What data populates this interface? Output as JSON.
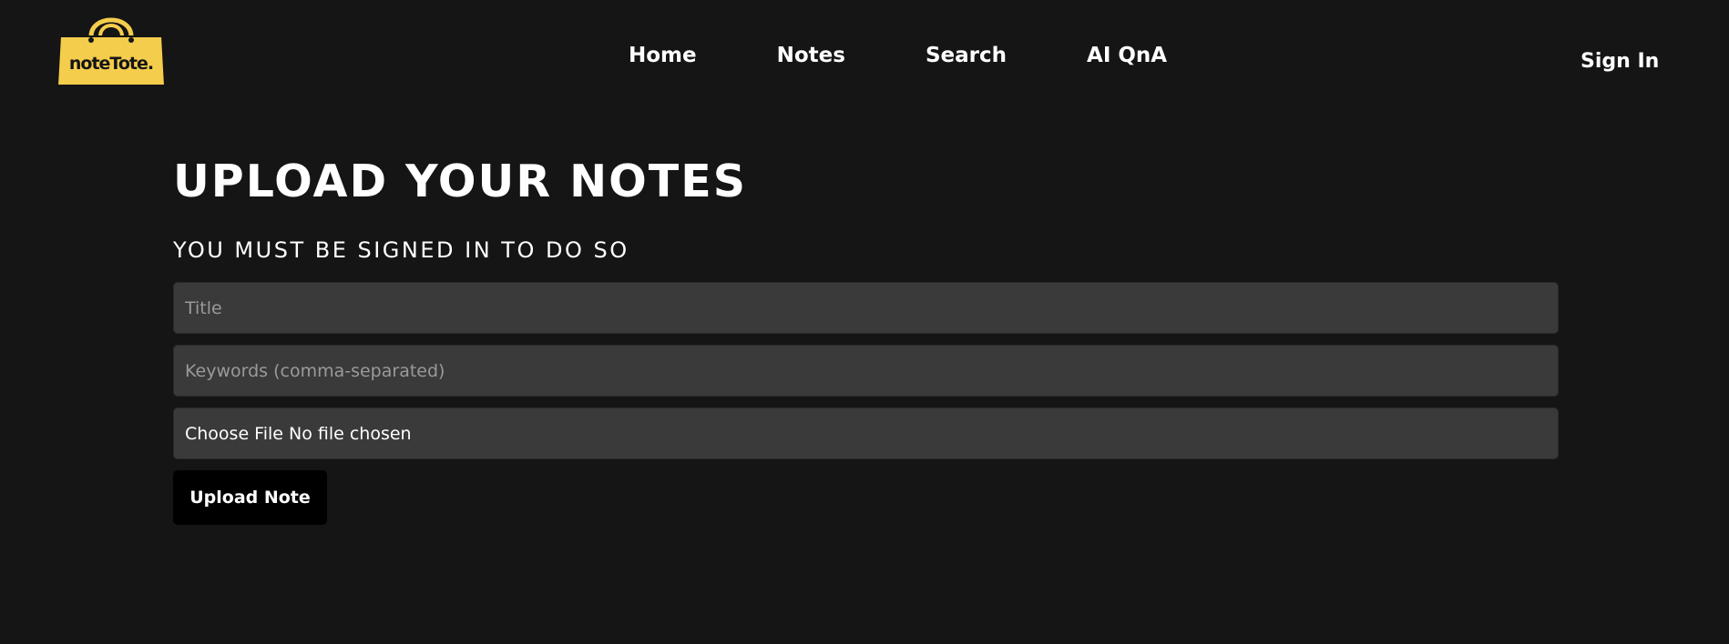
{
  "header": {
    "logo_text": "noteTote.",
    "nav": [
      {
        "label": "Home"
      },
      {
        "label": "Notes"
      },
      {
        "label": "Search"
      },
      {
        "label": "AI QnA"
      }
    ],
    "sign_in_label": "Sign In"
  },
  "main": {
    "title": "UPLOAD YOUR NOTES",
    "subtitle": "YOU MUST BE SIGNED IN TO DO SO",
    "form": {
      "title_placeholder": "Title",
      "keywords_placeholder": "Keywords (comma-separated)",
      "file_button_label": "Choose File",
      "file_status": "No file chosen",
      "submit_label": "Upload Note"
    }
  },
  "colors": {
    "background": "#151515",
    "input_background": "#3a3a3a",
    "logo_yellow": "#f5cd4c",
    "button_background": "#000000"
  },
  "icons": {
    "logo": "shopping-bag-logo-icon"
  }
}
